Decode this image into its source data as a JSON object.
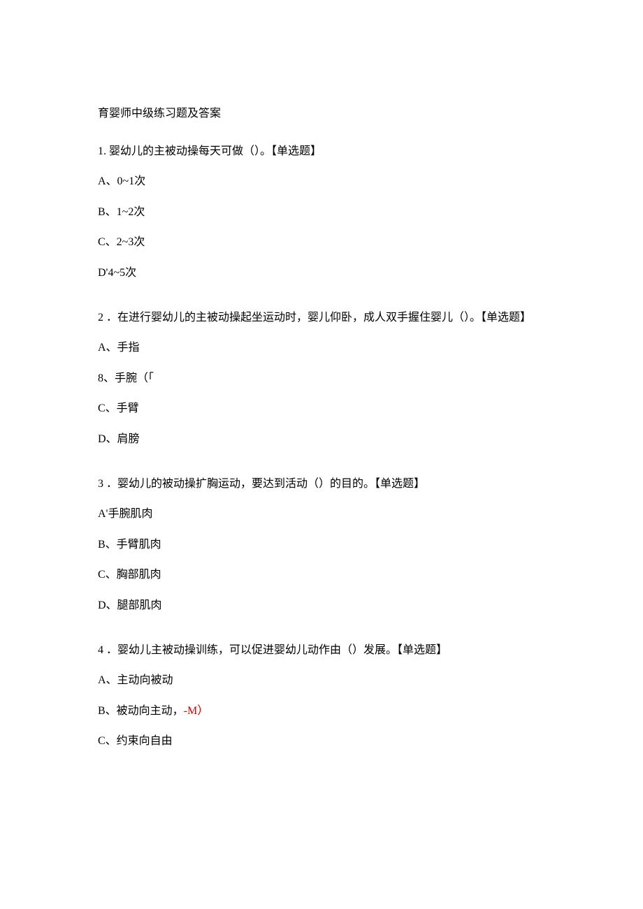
{
  "title": "育婴师中级练习题及答案",
  "questions": [
    {
      "number": "1.",
      "text": "婴幼儿的主被动操每天可做（）。【单选题】",
      "options": [
        {
          "label": "A、0~1次",
          "red": ""
        },
        {
          "label": "B、1~2次",
          "red": ""
        },
        {
          "label": "C、2~3次",
          "red": ""
        },
        {
          "label": "D'4~5次",
          "red": ""
        }
      ]
    },
    {
      "number": "2",
      "text": "．在进行婴幼儿的主被动操起坐运动时，婴儿仰卧，成人双手握住婴儿（）。【单选题】",
      "options": [
        {
          "label": "A、手指",
          "red": ""
        },
        {
          "label": "8、手腕（「",
          "red": ""
        },
        {
          "label": "C、手臂",
          "red": ""
        },
        {
          "label": "D、肩膀",
          "red": ""
        }
      ]
    },
    {
      "number": "3",
      "text": "．婴幼儿的被动操扩胸运动，要达到活动（）的目的。【单选题】",
      "options": [
        {
          "label": "A'手腕肌肉",
          "red": ""
        },
        {
          "label": "B、手臂肌肉",
          "red": ""
        },
        {
          "label": "C、胸部肌肉",
          "red": ""
        },
        {
          "label": "D、腿部肌肉",
          "red": ""
        }
      ]
    },
    {
      "number": "4",
      "text": "．婴幼儿主被动操训练，可以促进婴幼儿动作由（）发展。【单选题】",
      "options": [
        {
          "label": "A、主动向被动",
          "red": ""
        },
        {
          "label": "B、被动向主动，",
          "red": "-M）"
        },
        {
          "label": "C、约束向自由",
          "red": ""
        }
      ]
    }
  ]
}
